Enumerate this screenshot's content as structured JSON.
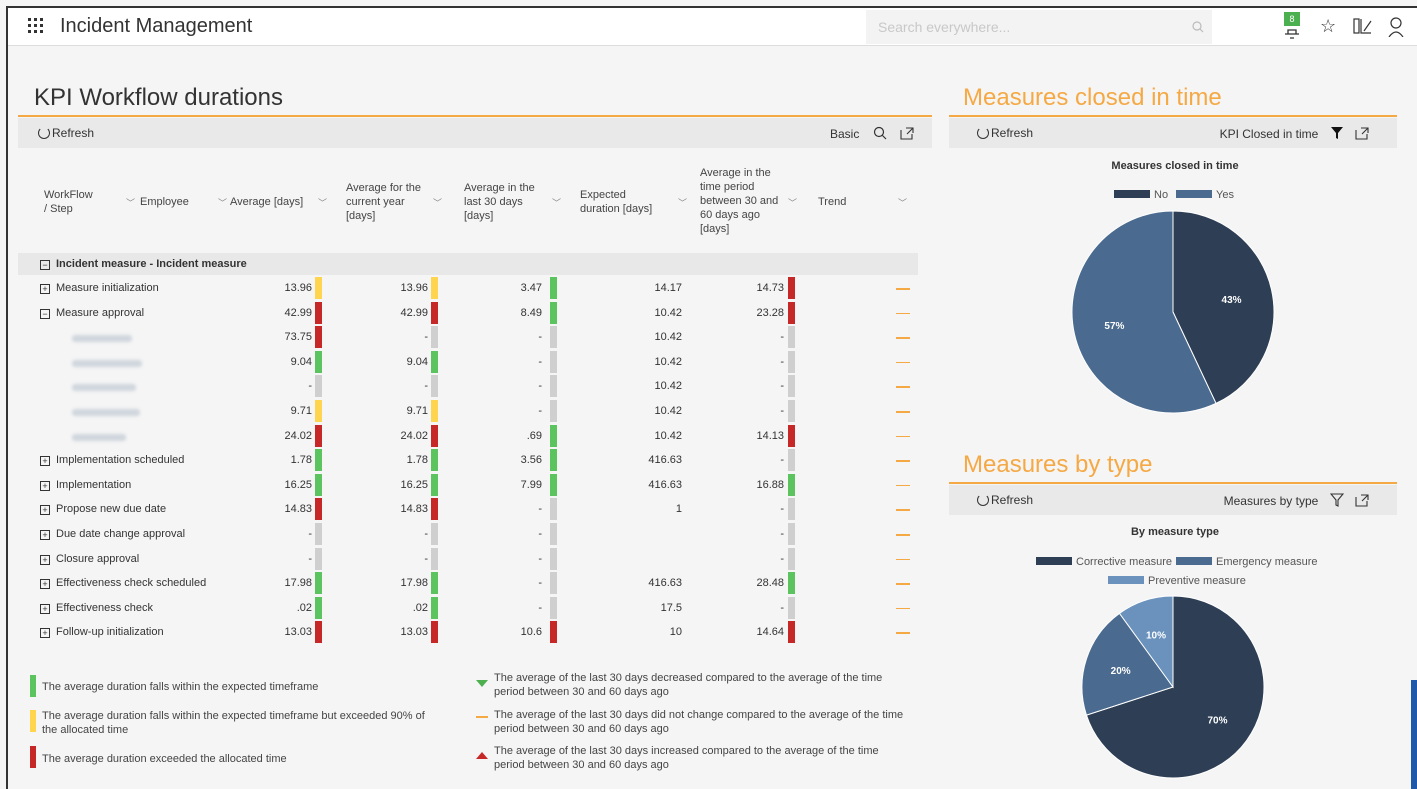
{
  "app": {
    "title": "Incident Management",
    "search_placeholder": "Search everywhere...",
    "notif_count": "8"
  },
  "kpi": {
    "title": "KPI Workflow durations",
    "refresh": "Refresh",
    "view": "Basic",
    "headers": [
      "WorkFlow / Step",
      "Employee",
      "Average [days]",
      "Average for the current year [days]",
      "Average in the last 30 days [days]",
      "Expected duration [days]",
      "Average in the time period between 30 and 60 days ago [days]",
      "Trend"
    ],
    "group": "Incident measure - Incident measure",
    "rows": [
      {
        "name": "Measure initialization",
        "pm": "+",
        "avg": "13.96",
        "avgc": "y",
        "year": "13.96",
        "yearc": "y",
        "last30": "3.47",
        "l30c": "g",
        "exp": "14.17",
        "p60": "14.73",
        "p60c": "r"
      },
      {
        "name": "Measure approval",
        "pm": "−",
        "avg": "42.99",
        "avgc": "r",
        "year": "42.99",
        "yearc": "r",
        "last30": "8.49",
        "l30c": "g",
        "exp": "10.42",
        "p60": "23.28",
        "p60c": "r"
      },
      {
        "name": "",
        "sub": true,
        "avg": "73.75",
        "avgc": "r",
        "year": "-",
        "yearc": "n",
        "last30": "-",
        "l30c": "n",
        "exp": "10.42",
        "p60": "-",
        "p60c": "n"
      },
      {
        "name": "",
        "sub": true,
        "avg": "9.04",
        "avgc": "g",
        "year": "9.04",
        "yearc": "g",
        "last30": "-",
        "l30c": "n",
        "exp": "10.42",
        "p60": "-",
        "p60c": "n"
      },
      {
        "name": "",
        "sub": true,
        "avg": "-",
        "avgc": "n",
        "year": "-",
        "yearc": "n",
        "last30": "-",
        "l30c": "n",
        "exp": "10.42",
        "p60": "-",
        "p60c": "n"
      },
      {
        "name": "",
        "sub": true,
        "avg": "9.71",
        "avgc": "y",
        "year": "9.71",
        "yearc": "y",
        "last30": "-",
        "l30c": "n",
        "exp": "10.42",
        "p60": "-",
        "p60c": "n"
      },
      {
        "name": "",
        "sub": true,
        "avg": "24.02",
        "avgc": "r",
        "year": "24.02",
        "yearc": "r",
        "last30": ".69",
        "l30c": "g",
        "exp": "10.42",
        "p60": "14.13",
        "p60c": "r"
      },
      {
        "name": "Implementation scheduled",
        "pm": "+",
        "avg": "1.78",
        "avgc": "g",
        "year": "1.78",
        "yearc": "g",
        "last30": "3.56",
        "l30c": "g",
        "exp": "416.63",
        "p60": "-",
        "p60c": "n"
      },
      {
        "name": "Implementation",
        "pm": "+",
        "avg": "16.25",
        "avgc": "g",
        "year": "16.25",
        "yearc": "g",
        "last30": "7.99",
        "l30c": "g",
        "exp": "416.63",
        "p60": "16.88",
        "p60c": "g"
      },
      {
        "name": "Propose new due date",
        "pm": "+",
        "avg": "14.83",
        "avgc": "r",
        "year": "14.83",
        "yearc": "r",
        "last30": "-",
        "l30c": "n",
        "exp": "1",
        "p60": "-",
        "p60c": "n"
      },
      {
        "name": "Due date change approval",
        "pm": "+",
        "avg": "-",
        "avgc": "n",
        "year": "-",
        "yearc": "n",
        "last30": "-",
        "l30c": "n",
        "exp": "",
        "p60": "-",
        "p60c": "n"
      },
      {
        "name": "Closure approval",
        "pm": "+",
        "avg": "-",
        "avgc": "n",
        "year": "-",
        "yearc": "n",
        "last30": "-",
        "l30c": "n",
        "exp": "",
        "p60": "-",
        "p60c": "n"
      },
      {
        "name": "Effectiveness check scheduled",
        "pm": "+",
        "avg": "17.98",
        "avgc": "g",
        "year": "17.98",
        "yearc": "g",
        "last30": "-",
        "l30c": "n",
        "exp": "416.63",
        "p60": "28.48",
        "p60c": "g"
      },
      {
        "name": "Effectiveness check",
        "pm": "+",
        "avg": ".02",
        "avgc": "g",
        "year": ".02",
        "yearc": "g",
        "last30": "-",
        "l30c": "n",
        "exp": "17.5",
        "p60": "-",
        "p60c": "n"
      },
      {
        "name": "Follow-up initialization",
        "pm": "+",
        "avg": "13.03",
        "avgc": "r",
        "year": "13.03",
        "yearc": "r",
        "last30": "10.6",
        "l30c": "r",
        "exp": "10",
        "p60": "14.64",
        "p60c": "r"
      }
    ],
    "legend": {
      "green": "The average duration falls within the expected timeframe",
      "yellow": "The average duration falls within the expected timeframe but exceeded 90% of the allocated time",
      "red": "The average duration exceeded the allocated time",
      "down": "The average of the last 30 days decreased compared to the average of the time period between 30 and 60 days ago",
      "same": "The average of the last 30 days did not change compared to the average of the time period between 30 and 60 days ago",
      "up": "The average of the last 30 days increased compared to the average of the time period between 30 and 60 days ago"
    }
  },
  "closed": {
    "title": "Measures closed in time",
    "refresh": "Refresh",
    "filter_label": "KPI Closed in time"
  },
  "bytype": {
    "title": "Measures by type",
    "refresh": "Refresh",
    "filter_label": "Measures by type"
  },
  "chart_data": [
    {
      "type": "pie",
      "title": "Measures closed in time",
      "categories": [
        "No",
        "Yes"
      ],
      "values": [
        43,
        57
      ],
      "colors": [
        "#2d3e55",
        "#4a6a8f"
      ],
      "legend": "top"
    },
    {
      "type": "pie",
      "title": "By measure type",
      "categories": [
        "Corrective measure",
        "Emergency measure",
        "Preventive measure"
      ],
      "values": [
        70,
        20,
        10
      ],
      "colors": [
        "#2d3e55",
        "#4a6a8f",
        "#6a92bd"
      ],
      "legend": "top"
    }
  ]
}
